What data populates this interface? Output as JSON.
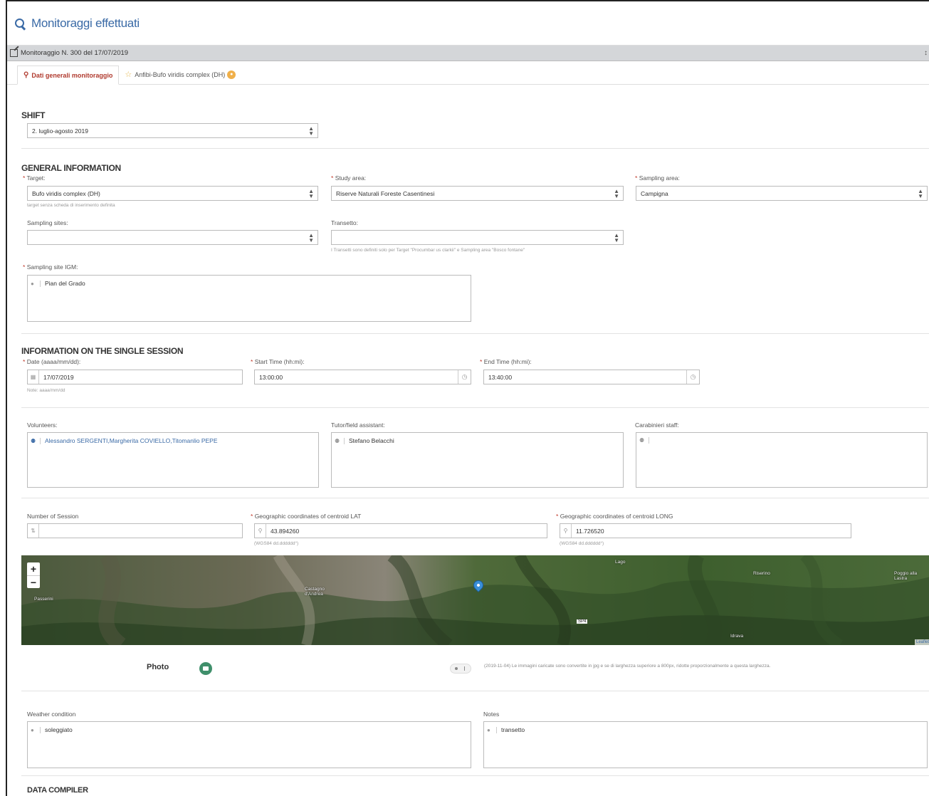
{
  "header": {
    "title": "Monitoraggi effettuati"
  },
  "panel": {
    "title": "Monitoraggio N. 300 del 17/07/2019"
  },
  "tabs": [
    {
      "label": "Dati generali monitoraggio",
      "icon": "map-pin-icon"
    },
    {
      "label": "Anfibi-Bufo viridis complex (DH)",
      "icon": "star-icon"
    }
  ],
  "shift": {
    "title": "SHIFT",
    "value": "2. luglio-agosto 2019"
  },
  "general": {
    "title": "GENERAL INFORMATION",
    "target_label": "Target:",
    "target_value": "Bufo viridis complex (DH)",
    "target_help": "target senza scheda di inserimento definita",
    "study_label": "Study area:",
    "study_value": "Riserve Naturali Foreste Casentinesi",
    "sampling_area_label": "Sampling area:",
    "sampling_area_value": "Campigna",
    "sampling_sites_label": "Sampling sites:",
    "sampling_sites_value": "",
    "transetto_label": "Transetto:",
    "transetto_value": "",
    "transetto_help": "I Transetti sono definiti solo per Target \"Procumbar us clarkii\" e Sampling area \"Bosco fontane\"",
    "igm_label": "Sampling site IGM:",
    "igm_value": "Pian del Grado"
  },
  "session": {
    "title": "INFORMATION ON THE SINGLE SESSION",
    "date_label": "Date (aaaa/mm/dd):",
    "date_value": "17/07/2019",
    "date_help": "Note: aaaa/mm/dd",
    "start_label": "Start Time (hh:mi):",
    "start_value": "13:00:00",
    "end_label": "End Time (hh:mi):",
    "end_value": "13:40:00",
    "volunteers_label": "Volunteers:",
    "volunteers_value": "Alessandro SERGENTI,Margherita COVIELLO,Titomanlio PEPE",
    "tutor_label": "Tutor/field assistant:",
    "tutor_value": "Stefano Belacchi",
    "carabinieri_label": "Carabinieri staff:",
    "carabinieri_value": "",
    "session_num_label": "Number of Session",
    "session_num_value": "",
    "lat_label": "Geographic coordinates of centroid LAT",
    "lat_value": "43.894260",
    "lat_help": "(WGS84 dd.dddddd°)",
    "long_label": "Geographic coordinates of centroid LONG",
    "long_value": "11.726520",
    "long_help": "(WGS84 dd.dddddd°)"
  },
  "map": {
    "zoom_in": "+",
    "zoom_out": "−",
    "places": [
      "Passerini",
      "Castagno d'Andrea",
      "Lago",
      "Riserino",
      "Poggio alla Lastra",
      "Idrava",
      "SP4"
    ],
    "attribution": "Leaflet"
  },
  "photo": {
    "label": "Photo",
    "note": "(2019-11-04) Le immagini caricate sono convertite in jpg e se di larghezza superiore a 800px, ridotte proporzionalmente a questa larghezza."
  },
  "weather": {
    "label": "Weather condition",
    "value": "soleggiato"
  },
  "notes": {
    "label": "Notes",
    "value": "transetto"
  },
  "compiler": {
    "title": "DATA COMPILER"
  },
  "required_mark": "*",
  "colors": {
    "accent_blue": "#3a6aa6",
    "required_red": "#c0392b",
    "tab_active": "#b03a2e"
  }
}
